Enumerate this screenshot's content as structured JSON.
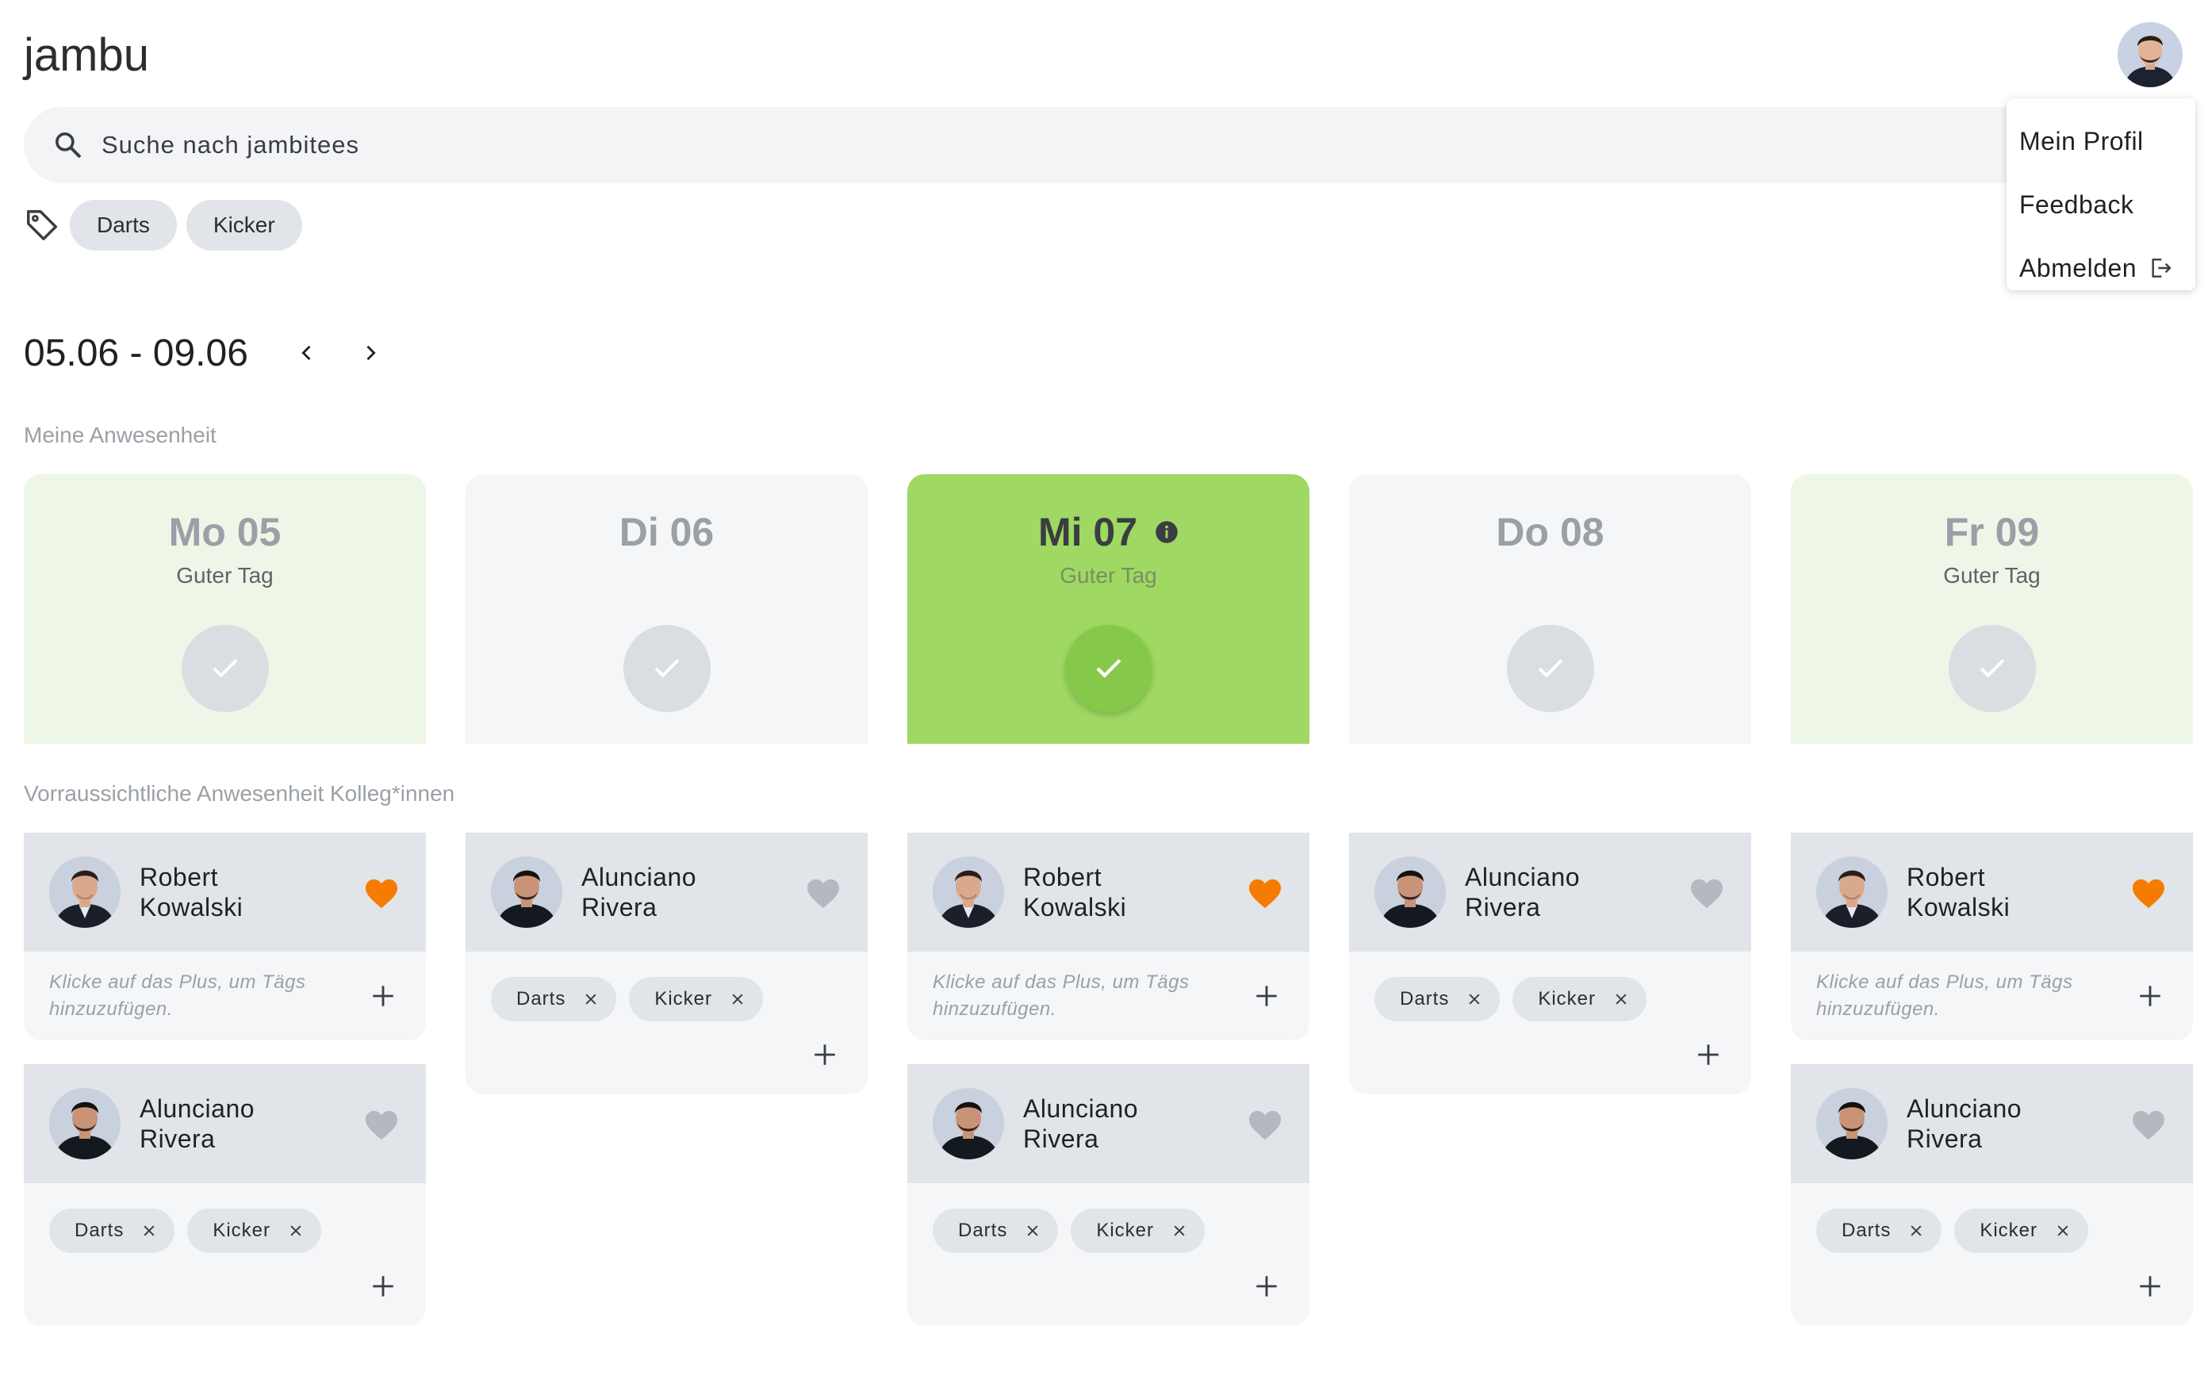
{
  "app": {
    "title": "jambu"
  },
  "search": {
    "placeholder": "Suche nach jambitees"
  },
  "filters": {
    "chips": [
      "Darts",
      "Kicker"
    ]
  },
  "user_menu": {
    "items": [
      "Mein Profil",
      "Feedback",
      "Abmelden"
    ]
  },
  "week": {
    "range": "05.06 - 09.06"
  },
  "sections": {
    "my_presence": "Meine Anwesenheit",
    "colleagues": "Vorraussichtliche Anwesenheit Kolleg*innen"
  },
  "days": [
    {
      "label": "Mo 05",
      "subtitle": "Guter Tag",
      "state": "light"
    },
    {
      "label": "Di 06",
      "subtitle": "",
      "state": "gray"
    },
    {
      "label": "Mi 07",
      "subtitle": "Guter Tag",
      "state": "active"
    },
    {
      "label": "Do 08",
      "subtitle": "",
      "state": "gray"
    },
    {
      "label": "Fr 09",
      "subtitle": "Guter Tag",
      "state": "light"
    }
  ],
  "colleagues": [
    [
      {
        "first": "Robert",
        "last": "Kowalski",
        "fav": true,
        "hint": "Klicke auf das Plus, um Tägs hinzuzufügen.",
        "tags": []
      },
      {
        "first": "Alunciano",
        "last": "Rivera",
        "fav": false,
        "tags": [
          "Darts",
          "Kicker"
        ]
      }
    ],
    [
      {
        "first": "Alunciano",
        "last": "Rivera",
        "fav": false,
        "tags": [
          "Darts",
          "Kicker"
        ]
      }
    ],
    [
      {
        "first": "Robert",
        "last": "Kowalski",
        "fav": true,
        "hint": "Klicke auf das Plus, um Tägs hinzuzufügen.",
        "tags": []
      },
      {
        "first": "Alunciano",
        "last": "Rivera",
        "fav": false,
        "tags": [
          "Darts",
          "Kicker"
        ]
      }
    ],
    [
      {
        "first": "Alunciano",
        "last": "Rivera",
        "fav": false,
        "tags": [
          "Darts",
          "Kicker"
        ]
      }
    ],
    [
      {
        "first": "Robert",
        "last": "Kowalski",
        "fav": true,
        "hint": "Klicke auf das Plus, um Tägs hinzuzufügen.",
        "tags": []
      },
      {
        "first": "Alunciano",
        "last": "Rivera",
        "fav": false,
        "tags": [
          "Darts",
          "Kicker"
        ]
      }
    ]
  ],
  "colors": {
    "favorite": "#f57c00",
    "not_favorite": "#b5b9bf",
    "active_day": "#9fd862",
    "light_day": "#eef6e7"
  }
}
